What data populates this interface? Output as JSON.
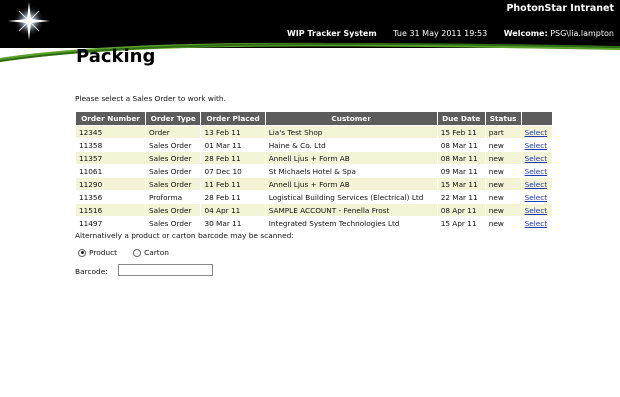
{
  "header": {
    "brand": "PhotonStar Intranet",
    "system_name": "WIP Tracker System",
    "datetime": "Tue 31 May 2011 19:53",
    "welcome_label": "Welcome:",
    "user": "PSG\\lia.lampton",
    "logo_icon": "star-burst-icon"
  },
  "page": {
    "title": "Packing",
    "prompt": "Please select a Sales Order to work with."
  },
  "table": {
    "headers": [
      "Order Number",
      "Order Type",
      "Order Placed",
      "Customer",
      "Due Date",
      "Status",
      ""
    ],
    "rows": [
      {
        "order_number": "12345",
        "order_type": "Order",
        "order_placed": "13 Feb 11",
        "customer": "Lia's Test Shop",
        "due_date": "15 Feb 11",
        "status": "part",
        "action": "Select"
      },
      {
        "order_number": "11358",
        "order_type": "Sales Order",
        "order_placed": "01 Mar 11",
        "customer": "Haine & Co. Ltd",
        "due_date": "08 Mar 11",
        "status": "new",
        "action": "Select"
      },
      {
        "order_number": "11357",
        "order_type": "Sales Order",
        "order_placed": "28 Feb 11",
        "customer": "Annell Ljus + Form AB",
        "due_date": "08 Mar 11",
        "status": "new",
        "action": "Select"
      },
      {
        "order_number": "11061",
        "order_type": "Sales Order",
        "order_placed": "07 Dec 10",
        "customer": "St Michaels Hotel & Spa",
        "due_date": "09 Mar 11",
        "status": "new",
        "action": "Select"
      },
      {
        "order_number": "11290",
        "order_type": "Sales Order",
        "order_placed": "11 Feb 11",
        "customer": "Annell Ljus + Form AB",
        "due_date": "15 Mar 11",
        "status": "new",
        "action": "Select"
      },
      {
        "order_number": "11356",
        "order_type": "Proforma",
        "order_placed": "28 Feb 11",
        "customer": "Logistical Building Services (Electrical) Ltd",
        "due_date": "22 Mar 11",
        "status": "new",
        "action": "Select"
      },
      {
        "order_number": "11516",
        "order_type": "Sales Order",
        "order_placed": "04 Apr 11",
        "customer": "SAMPLE ACCOUNT - Fenella Frost",
        "due_date": "08 Apr 11",
        "status": "new",
        "action": "Select"
      },
      {
        "order_number": "11497",
        "order_type": "Sales Order",
        "order_placed": "30 Mar 11",
        "customer": "Integrated System Technologies Ltd",
        "due_date": "15 Apr 11",
        "status": "new",
        "action": "Select"
      }
    ]
  },
  "scan": {
    "prompt": "Alternatively a product or carton barcode may be scanned:",
    "options": [
      "Product",
      "Carton"
    ],
    "selected": "Product",
    "barcode_label": "Barcode:",
    "barcode_value": ""
  },
  "colors": {
    "header_bg": "#000000",
    "accent_green": "#5aa02c",
    "table_header_bg": "#5c5c5c",
    "row_alt_bg": "#f3f3d6",
    "link": "#1f3bb5"
  }
}
